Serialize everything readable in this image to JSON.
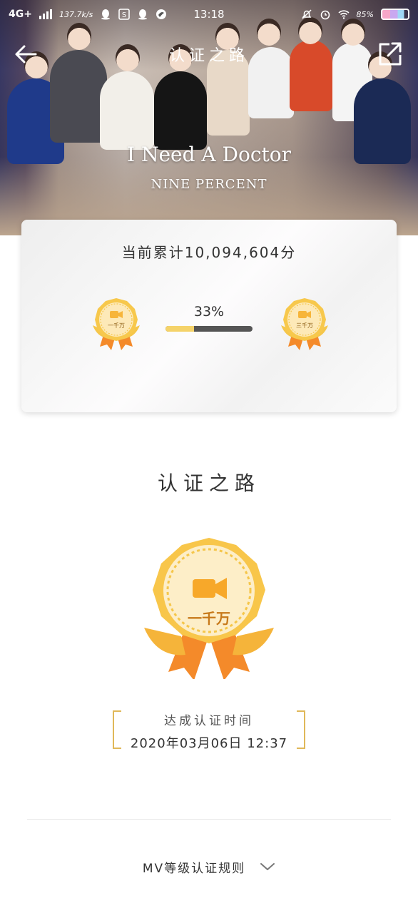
{
  "status_bar": {
    "network": "4G+",
    "speed": "137.7k/s",
    "time": "13:18",
    "battery": "85%"
  },
  "header": {
    "title": "认证之路",
    "song_title": "I Need A Doctor",
    "artist": "NINE PERCENT"
  },
  "progress_card": {
    "total_text": "当前累计10,094,604分",
    "percent_text": "33%",
    "percent_value": 0.33,
    "current_medal": "一千万",
    "next_medal": "三千万"
  },
  "main": {
    "section_title": "认证之路",
    "medal_label": "一千万",
    "achieved_label": "达成认证时间",
    "achieved_time": "2020年03月06日 12:37"
  },
  "footer": {
    "rules_label": "MV等级认证规则"
  },
  "colors": {
    "gold": "#f5c64a",
    "bar_fill": "#f5d36a",
    "bracket": "#e0b85a"
  }
}
